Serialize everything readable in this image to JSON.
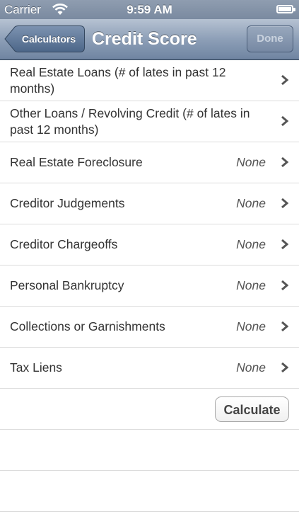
{
  "status_bar": {
    "carrier": "Carrier",
    "time": "9:59 AM",
    "wifi_icon": "wifi-icon",
    "battery_icon": "battery-icon"
  },
  "nav": {
    "back_label": "Calculators",
    "title": "Credit Score",
    "done_label": "Done"
  },
  "rows": [
    {
      "label": "Real Estate Loans (# of lates in past 12 months)",
      "value": ""
    },
    {
      "label": "Other Loans / Revolving Credit (# of lates in past 12 months)",
      "value": ""
    },
    {
      "label": "Real Estate Foreclosure",
      "value": "None"
    },
    {
      "label": "Creditor Judgements",
      "value": "None"
    },
    {
      "label": "Creditor Chargeoffs",
      "value": "None"
    },
    {
      "label": "Personal Bankruptcy",
      "value": "None"
    },
    {
      "label": "Collections or Garnishments",
      "value": "None"
    },
    {
      "label": "Tax Liens",
      "value": "None"
    }
  ],
  "calculate_label": "Calculate",
  "colors": {
    "nav_top": "#b6c2d2",
    "nav_bottom": "#6f84a1",
    "separator": "#dcdcdc",
    "text": "#333333"
  }
}
